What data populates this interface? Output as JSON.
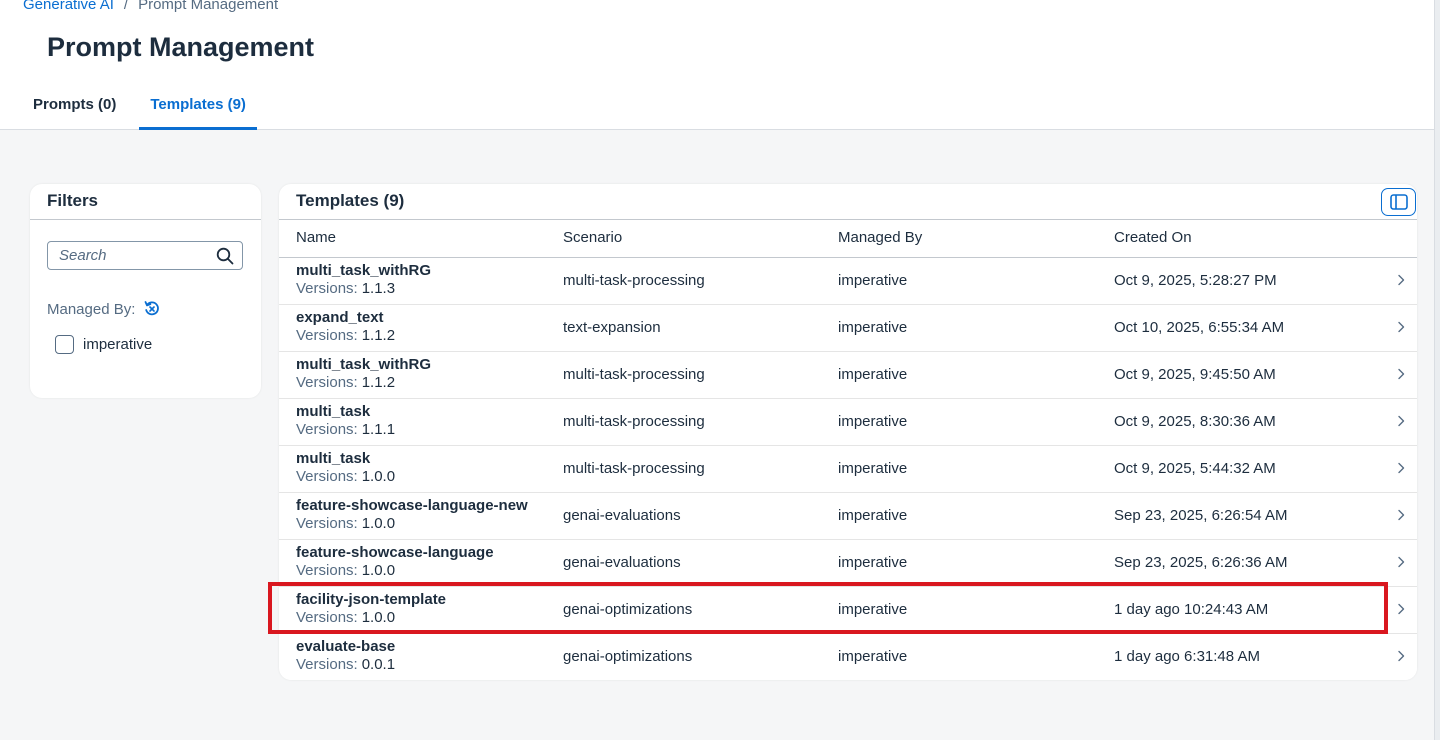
{
  "breadcrumb": {
    "parent": "Generative AI",
    "separator": "/",
    "current": "Prompt Management"
  },
  "page_title": "Prompt Management",
  "tabs": [
    {
      "label": "Prompts (0)",
      "active": false
    },
    {
      "label": "Templates (9)",
      "active": true
    }
  ],
  "filters": {
    "title": "Filters",
    "search_placeholder": "Search",
    "managed_by_label": "Managed By:",
    "options": [
      {
        "label": "imperative",
        "checked": false
      }
    ]
  },
  "table": {
    "title": "Templates (9)",
    "columns": {
      "name": "Name",
      "scenario": "Scenario",
      "managed_by": "Managed By",
      "created_on": "Created On"
    },
    "version_label": "Versions:",
    "rows": [
      {
        "name": "multi_task_withRG",
        "version": "1.1.3",
        "scenario": "multi-task-processing",
        "managed_by": "imperative",
        "created_on": "Oct 9, 2025, 5:28:27 PM"
      },
      {
        "name": "expand_text",
        "version": "1.1.2",
        "scenario": "text-expansion",
        "managed_by": "imperative",
        "created_on": "Oct 10, 2025, 6:55:34 AM"
      },
      {
        "name": "multi_task_withRG",
        "version": "1.1.2",
        "scenario": "multi-task-processing",
        "managed_by": "imperative",
        "created_on": "Oct 9, 2025, 9:45:50 AM"
      },
      {
        "name": "multi_task",
        "version": "1.1.1",
        "scenario": "multi-task-processing",
        "managed_by": "imperative",
        "created_on": "Oct 9, 2025, 8:30:36 AM"
      },
      {
        "name": "multi_task",
        "version": "1.0.0",
        "scenario": "multi-task-processing",
        "managed_by": "imperative",
        "created_on": "Oct 9, 2025, 5:44:32 AM"
      },
      {
        "name": "feature-showcase-language-new",
        "version": "1.0.0",
        "scenario": "genai-evaluations",
        "managed_by": "imperative",
        "created_on": "Sep 23, 2025, 6:26:54 AM"
      },
      {
        "name": "feature-showcase-language",
        "version": "1.0.0",
        "scenario": "genai-evaluations",
        "managed_by": "imperative",
        "created_on": "Sep 23, 2025, 6:26:36 AM"
      },
      {
        "name": "facility-json-template",
        "version": "1.0.0",
        "scenario": "genai-optimizations",
        "managed_by": "imperative",
        "created_on": "1 day ago 10:24:43 AM"
      },
      {
        "name": "evaluate-base",
        "version": "0.0.1",
        "scenario": "genai-optimizations",
        "managed_by": "imperative",
        "created_on": "1 day ago 6:31:48 AM"
      }
    ]
  },
  "colors": {
    "accent": "#0a6ed1",
    "highlight": "#d9171f",
    "text": "#1d2d3e",
    "muted": "#556b82"
  },
  "icons": {
    "search": "search-icon",
    "reset": "reset-filter-icon",
    "panel_toggle": "side-panel-icon",
    "row_nav": "chevron-right-icon"
  }
}
